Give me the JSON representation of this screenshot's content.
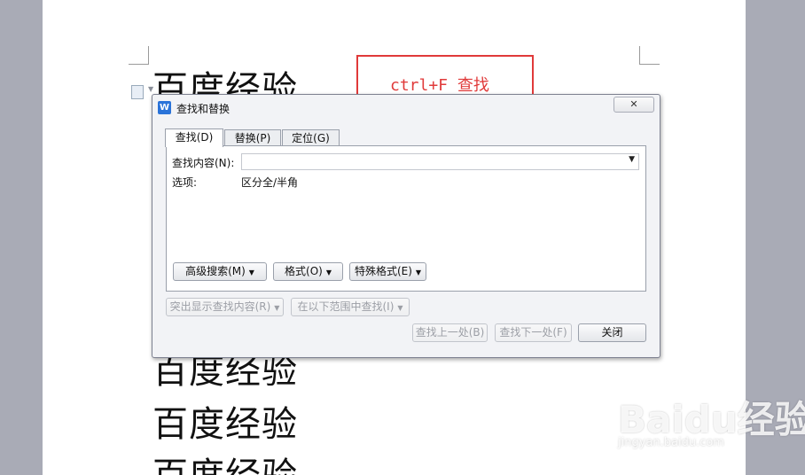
{
  "document": {
    "lines": [
      "百度经验",
      "百度经验",
      "百度经验",
      "百度经验"
    ]
  },
  "annotation": {
    "text": "ctrl+F 查找",
    "color": "#e03a3a"
  },
  "dialog": {
    "title": "查找和替换",
    "close_glyph": "✕",
    "tabs": [
      {
        "label": "查找(D)",
        "active": true
      },
      {
        "label": "替换(P)",
        "active": false
      },
      {
        "label": "定位(G)",
        "active": false
      }
    ],
    "find_label": "查找内容(N):",
    "find_value": "",
    "options_label": "选项:",
    "options_value": "区分全/半角",
    "advanced_button": "高级搜索(M)",
    "format_button": "格式(O)",
    "special_button": "特殊格式(E)",
    "highlight_button": "突出显示查找内容(R)",
    "range_button": "在以下范围中查找(I)",
    "find_prev_button": "查找上一处(B)",
    "find_next_button": "查找下一处(F)",
    "close_button": "关闭"
  },
  "watermark": {
    "brand": "Baidu经验",
    "url": "jingyan.baidu.com"
  }
}
